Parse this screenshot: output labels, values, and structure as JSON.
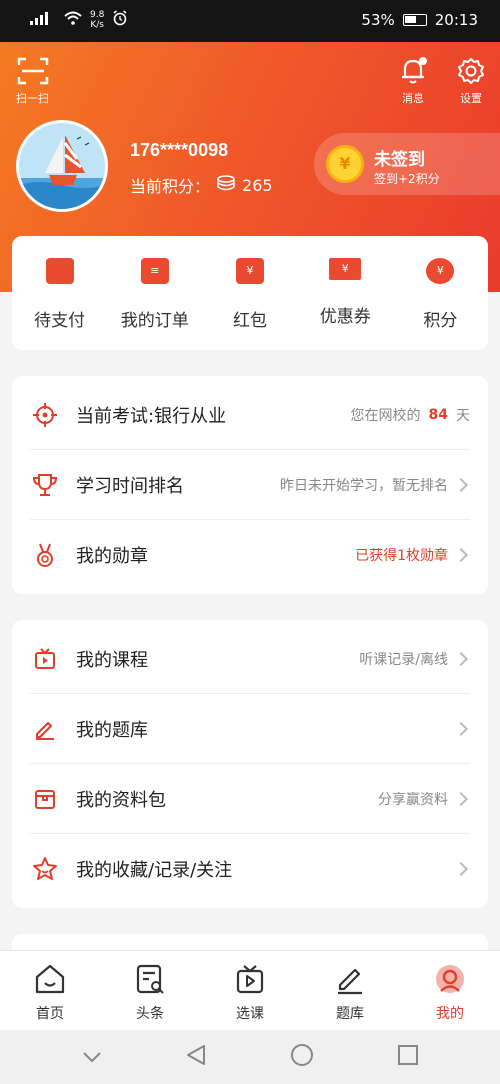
{
  "status_bar": {
    "signal": "“”",
    "net_speed_value": "9.8",
    "net_speed_unit": "K/s",
    "battery": "53%",
    "time": "20:13"
  },
  "header": {
    "scan_label": "扫一扫",
    "messages_label": "消息",
    "settings_label": "设置"
  },
  "user": {
    "phone": "176****0098",
    "points_label": "当前积分：",
    "points_value": "265"
  },
  "signin": {
    "title": "未签到",
    "subtitle": "签到+2积分",
    "coin_symbol": "¥"
  },
  "orders": [
    {
      "label": "待支付",
      "icon": "wallet-icon"
    },
    {
      "label": "我的订单",
      "icon": "order-icon"
    },
    {
      "label": "红包",
      "icon": "red-packet-icon"
    },
    {
      "label": "优惠券",
      "icon": "coupon-icon"
    },
    {
      "label": "积分",
      "icon": "points-icon"
    }
  ],
  "study": {
    "exam": {
      "label": "当前考试:银行从业",
      "prefix": "您在网校的",
      "days": "84",
      "suffix": "天"
    },
    "ranking": {
      "label": "学习时间排名",
      "value": "昨日未开始学习，暂无排名"
    },
    "medal": {
      "label": "我的勋章",
      "value": "已获得1枚勋章"
    }
  },
  "content": {
    "courses": {
      "label": "我的课程",
      "value": "听课记录/离线"
    },
    "question_bank": {
      "label": "我的题库",
      "value": ""
    },
    "materials": {
      "label": "我的资料包",
      "value": "分享赢资料"
    },
    "favorites": {
      "label": "我的收藏/记录/关注",
      "value": ""
    }
  },
  "tabs": [
    {
      "label": "首页",
      "icon": "home-icon"
    },
    {
      "label": "头条",
      "icon": "news-icon"
    },
    {
      "label": "选课",
      "icon": "course-select-icon"
    },
    {
      "label": "题库",
      "icon": "question-bank-icon"
    },
    {
      "label": "我的",
      "icon": "profile-icon"
    }
  ],
  "colors": {
    "accent": "#e33d2c",
    "hero_start": "#f47a22",
    "hero_end": "#ea3b2c",
    "coin": "#ffd233"
  }
}
